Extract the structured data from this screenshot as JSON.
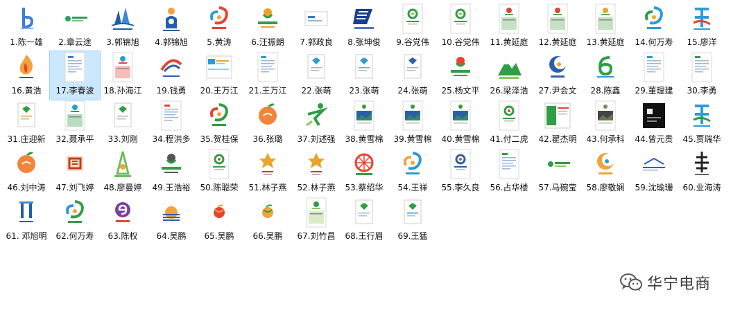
{
  "window": {
    "background": "#ffffff",
    "selection_color": "#cce8ff"
  },
  "watermark": {
    "text": "华宁电商",
    "icon": "wechat-icon"
  },
  "files": [
    {
      "label": "1.陈一雄",
      "thumb": "letter-b",
      "c1": "#3b7fd1",
      "c2": "#7fb2e8"
    },
    {
      "label": "2.章云途",
      "thumb": "wordmark",
      "c1": "#2e9e5b",
      "c2": "#7cc36a"
    },
    {
      "label": "3.郭锦旭",
      "thumb": "building",
      "c1": "#1f5fa8",
      "c2": "#3f88d6"
    },
    {
      "label": "4.郭锦旭",
      "thumb": "figure",
      "c1": "#1f5fa8",
      "c2": "#f2a33a"
    },
    {
      "label": "5.黄涛",
      "thumb": "swirl",
      "c1": "#e8432f",
      "c2": "#2d9bd8"
    },
    {
      "label": "6.汪振朗",
      "thumb": "text-logo",
      "c1": "#2f9e44",
      "c2": "#e8a42c"
    },
    {
      "label": "7.郭政良",
      "thumb": "card",
      "c1": "#2a7fd0",
      "c2": "#9bb7d8"
    },
    {
      "label": "8.张坤俊",
      "thumb": "stripe",
      "c1": "#1b3f8f",
      "c2": "#4f79c9"
    },
    {
      "label": "9.谷党伟",
      "thumb": "doc-circle",
      "c1": "#2f9e44",
      "c2": "#8cc95f"
    },
    {
      "label": "10.谷党伟",
      "thumb": "doc-circle",
      "c1": "#2f9e44",
      "c2": "#8cc95f"
    },
    {
      "label": "11.黄延庭",
      "thumb": "doc-top",
      "c1": "#d64a32",
      "c2": "#55a84e"
    },
    {
      "label": "12.黄延庭",
      "thumb": "doc-top",
      "c1": "#d64a32",
      "c2": "#55a84e"
    },
    {
      "label": "13.黄延庭",
      "thumb": "doc-top",
      "c1": "#e8a42c",
      "c2": "#55a84e"
    },
    {
      "label": "14.何万寿",
      "thumb": "swirl",
      "c1": "#2d9bd8",
      "c2": "#2f9e44"
    },
    {
      "label": "15.廖洋",
      "thumb": "character",
      "c1": "#2d9bd8",
      "c2": "#e8432f"
    },
    {
      "label": "16.黄浩",
      "thumb": "flame",
      "c1": "#f2a33a",
      "c2": "#e8432f"
    },
    {
      "label": "17.李春波",
      "thumb": "doc-lines",
      "c1": "#3b7fd1",
      "c2": "#9bb7d8"
    },
    {
      "label": "18.孙海江",
      "thumb": "doc-top",
      "c1": "#2d9bd8",
      "c2": "#e8432f"
    },
    {
      "label": "19.钱勇",
      "thumb": "arc",
      "c1": "#e8432f",
      "c2": "#2d5fa8"
    },
    {
      "label": "20.王万江",
      "thumb": "doc-strip",
      "c1": "#2d9bd8",
      "c2": "#e8a42c"
    },
    {
      "label": "21.王万江",
      "thumb": "doc-lines",
      "c1": "#2d9bd8",
      "c2": "#9bb7d8"
    },
    {
      "label": "22.张萌",
      "thumb": "doc-small",
      "c1": "#2d9bd8",
      "c2": "#9bb7d8"
    },
    {
      "label": "23.张萌",
      "thumb": "doc-small",
      "c1": "#2d9bd8",
      "c2": "#6fbf5f"
    },
    {
      "label": "24.张萌",
      "thumb": "doc-small",
      "c1": "#2d5fa8",
      "c2": "#9bb7d8"
    },
    {
      "label": "25.杨文平",
      "thumb": "text-logo",
      "c1": "#2f9e44",
      "c2": "#e8432f"
    },
    {
      "label": "26.梁泽浩",
      "thumb": "mountain",
      "c1": "#2f9e44",
      "c2": "#8cc95f"
    },
    {
      "label": "27.尹会文",
      "thumb": "crescent",
      "c1": "#2d5fa8",
      "c2": "#f2a33a"
    },
    {
      "label": "28.陈鑫",
      "thumb": "six",
      "c1": "#2f9e44",
      "c2": "#2d9bd8"
    },
    {
      "label": "29.董理建",
      "thumb": "doc-lines",
      "c1": "#2d9bd8",
      "c2": "#9bb7d8"
    },
    {
      "label": "30.李勇",
      "thumb": "doc-lines",
      "c1": "#2f9e44",
      "c2": "#9bb7d8"
    },
    {
      "label": "31.庄迎新",
      "thumb": "doc-small",
      "c1": "#2f9e44",
      "c2": "#e8a42c"
    },
    {
      "label": "32.聂承平",
      "thumb": "doc-top",
      "c1": "#2d9bd8",
      "c2": "#2f9e44"
    },
    {
      "label": "33.刘刚",
      "thumb": "doc-small",
      "c1": "#2f9e44",
      "c2": "#9bb7d8"
    },
    {
      "label": "34.程洪多",
      "thumb": "doc-lines",
      "c1": "#e8432f",
      "c2": "#9bb7d8"
    },
    {
      "label": "35.贺桂保",
      "thumb": "swirl",
      "c1": "#2f9e44",
      "c2": "#e8432f"
    },
    {
      "label": "36.张璐",
      "thumb": "orange",
      "c1": "#f2853a",
      "c2": "#2f9e44"
    },
    {
      "label": "37.刘述强",
      "thumb": "runner",
      "c1": "#2f9e44",
      "c2": "#8cc95f"
    },
    {
      "label": "38.黄雪棉",
      "thumb": "doc-photo",
      "c1": "#2f9e44",
      "c2": "#2d5fa8"
    },
    {
      "label": "39.黄雪棉",
      "thumb": "doc-photo",
      "c1": "#2f9e44",
      "c2": "#2d5fa8"
    },
    {
      "label": "40.黄雪棉",
      "thumb": "doc-photo",
      "c1": "#2f9e44",
      "c2": "#2d5fa8"
    },
    {
      "label": "41.付二虎",
      "thumb": "doc-circle",
      "c1": "#2f9e44",
      "c2": "#e8432f"
    },
    {
      "label": "42.翟杰明",
      "thumb": "doc-wide",
      "c1": "#2f9e44",
      "c2": "#e8432f"
    },
    {
      "label": "43.何承科",
      "thumb": "doc-photo",
      "c1": "#6b8e5a",
      "c2": "#444444"
    },
    {
      "label": "44.曾元贵",
      "thumb": "dark",
      "c1": "#111111",
      "c2": "#eeeeee"
    },
    {
      "label": "45.贾瑞华",
      "thumb": "character",
      "c1": "#2d9bd8",
      "c2": "#2f9e44"
    },
    {
      "label": "46.刘中涛",
      "thumb": "orange",
      "c1": "#f2853a",
      "c2": "#2f9e44"
    },
    {
      "label": "47.刘飞婷",
      "thumb": "seal",
      "c1": "#c0392b",
      "c2": "#f2a33a"
    },
    {
      "label": "48.廖曼婷",
      "thumb": "bottle",
      "c1": "#6fbf5f",
      "c2": "#f2a33a"
    },
    {
      "label": "49.王浩裕",
      "thumb": "text-logo",
      "c1": "#2f9e44",
      "c2": "#555555"
    },
    {
      "label": "50.陈聪荣",
      "thumb": "doc-circle",
      "c1": "#2f9e44",
      "c2": "#e8432f"
    },
    {
      "label": "51.林子燕",
      "thumb": "ornament",
      "c1": "#e8a42c",
      "c2": "#c0392b"
    },
    {
      "label": "52.林子燕",
      "thumb": "ornament",
      "c1": "#e8a42c",
      "c2": "#c0392b"
    },
    {
      "label": "53.蔡绍华",
      "thumb": "radial",
      "c1": "#e8432f",
      "c2": "#2f9e44"
    },
    {
      "label": "54.王祥",
      "thumb": "swirl",
      "c1": "#2d9bd8",
      "c2": "#f2a33a"
    },
    {
      "label": "55.李久良",
      "thumb": "doc-circle",
      "c1": "#2d5fa8",
      "c2": "#e8432f"
    },
    {
      "label": "56.占华楼",
      "thumb": "doc-lines",
      "c1": "#2f9e44",
      "c2": "#9bb7d8"
    },
    {
      "label": "57.马碗莹",
      "thumb": "wordmark",
      "c1": "#2f9e44",
      "c2": "#8cc95f"
    },
    {
      "label": "58.廖敬娴",
      "thumb": "crescent",
      "c1": "#f2a33a",
      "c2": "#2d9bd8"
    },
    {
      "label": "59.沈瑜珊",
      "thumb": "line-logo",
      "c1": "#2d5fa8",
      "c2": "#9bb7d8"
    },
    {
      "label": "60.业海涛",
      "thumb": "tree",
      "c1": "#222222",
      "c2": "#666666"
    },
    {
      "label": "61. 邓旭明",
      "thumb": "pillar",
      "c1": "#1f5fa8",
      "c2": "#3f88d6"
    },
    {
      "label": "62.何万寿",
      "thumb": "swirl",
      "c1": "#2f9e44",
      "c2": "#2d9bd8"
    },
    {
      "label": "63.陈权",
      "thumb": "e-logo",
      "c1": "#7b3fa0",
      "c2": "#e8432f"
    },
    {
      "label": "64.吴鹏",
      "thumb": "sunrise",
      "c1": "#f2a33a",
      "c2": "#2d5fa8"
    },
    {
      "label": "65.吴鹏",
      "thumb": "ball",
      "c1": "#e8432f",
      "c2": "#f2a33a"
    },
    {
      "label": "66.吴鹏",
      "thumb": "ball",
      "c1": "#f2a33a",
      "c2": "#2f9e44"
    },
    {
      "label": "67.刘竹昌",
      "thumb": "doc-top",
      "c1": "#2f9e44",
      "c2": "#8cc95f"
    },
    {
      "label": "68.王行眉",
      "thumb": "doc-small",
      "c1": "#2f9e44",
      "c2": "#9bb7d8"
    },
    {
      "label": "69.王猛",
      "thumb": "doc-small",
      "c1": "#2f9e44",
      "c2": "#2d9bd8"
    }
  ],
  "selected_index": 16
}
